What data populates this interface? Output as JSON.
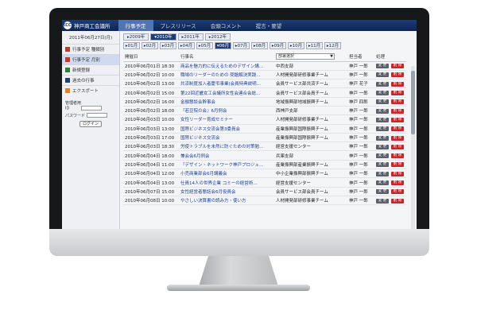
{
  "app": {
    "org_name": "神戸商工会議所",
    "logo_text": "KCCI"
  },
  "nav": {
    "tabs": [
      {
        "label": "行事予定",
        "active": true
      },
      {
        "label": "プレスリリース",
        "active": false
      },
      {
        "label": "会頭コメント",
        "active": false
      },
      {
        "label": "提言・要望",
        "active": false
      }
    ]
  },
  "sidebar": {
    "date": "2011年06月27日(月)",
    "items": [
      {
        "label": "行事予定 種類別",
        "icon": "calendar-icon",
        "active": false
      },
      {
        "label": "行事予定 月別",
        "icon": "calendar-icon",
        "active": true
      },
      {
        "label": "新規登録",
        "icon": "new-icon",
        "active": false
      },
      {
        "label": "過去の行事",
        "icon": "archive-icon",
        "active": false
      },
      {
        "label": "エクスポート",
        "icon": "export-icon",
        "active": false
      }
    ],
    "login": {
      "title": "管理者用",
      "id_label": "ID",
      "password_label": "パスワード",
      "button": "ログイン"
    }
  },
  "years": [
    {
      "label": "▸2009年",
      "active": false
    },
    {
      "label": "▾2010年",
      "active": true
    },
    {
      "label": "▸2011年",
      "active": false
    },
    {
      "label": "▸2012年",
      "active": false
    }
  ],
  "months": [
    {
      "label": "▸01月",
      "active": false
    },
    {
      "label": "▸02月",
      "active": false
    },
    {
      "label": "▸03月",
      "active": false
    },
    {
      "label": "▸04月",
      "active": false
    },
    {
      "label": "▸05月",
      "active": false
    },
    {
      "label": "▾06月",
      "active": true
    },
    {
      "label": "▸07月",
      "active": false
    },
    {
      "label": "▸08月",
      "active": false
    },
    {
      "label": "▸09月",
      "active": false
    },
    {
      "label": "▸10月",
      "active": false
    },
    {
      "label": "▸11月",
      "active": false
    },
    {
      "label": "▸12月",
      "active": false
    }
  ],
  "table": {
    "headers": [
      "開催日",
      "行事名",
      "",
      "担当者",
      "処理"
    ],
    "dept_filter": "部署選択",
    "edit_label": "変 更",
    "delete_label": "削 除",
    "rows": [
      {
        "date": "2010年06月01日 18:30",
        "title": "商品を魅力的に伝えるためのデザイン講…",
        "dept": "中西支部",
        "person": "神戸 一郎"
      },
      {
        "date": "2010年06月02日 10:00",
        "title": "職場のリーダーのための 問題解決実践…",
        "dept": "人材開発部研修事業チーム",
        "person": "神戸 一郎"
      },
      {
        "date": "2010年06月02日 13:00",
        "title": "共済制度加入者慶弔事業(会員特典説明…",
        "dept": "会員サービス部共済チーム",
        "person": "神戸 花子"
      },
      {
        "date": "2010年06月02日 15:00",
        "title": "第22回近畿女工会議所女性会連合会総…",
        "dept": "会員サービス部会員チーム",
        "person": "神戸 一郎"
      },
      {
        "date": "2010年06月02日 16:00",
        "title": "金融懇談会幹事会",
        "dept": "地域振興部地域振興チーム",
        "person": "神戸 四郎"
      },
      {
        "date": "2010年06月02日 18:00",
        "title": "『若豆院の会』6月例会",
        "dept": "西神戸支部",
        "person": "神戸 一郎"
      },
      {
        "date": "2010年06月03日 10:00",
        "title": "女性リーダー育成セミナー",
        "dept": "人材開発部研修事業チーム",
        "person": "神戸 一郎"
      },
      {
        "date": "2010年06月03日 13:00",
        "title": "国際ビジネス交流会第3委員会",
        "dept": "産業振興部国際振興チーム",
        "person": "神戸 一郎"
      },
      {
        "date": "2010年06月03日 17:00",
        "title": "国際ビジネス交流会",
        "dept": "産業振興部国際振興チーム",
        "person": "神戸 一郎"
      },
      {
        "date": "2010年06月03日 18:30",
        "title": "労使トラブルを未然に防ぐための対策勉…",
        "dept": "経営支援センター",
        "person": "神戸 一郎"
      },
      {
        "date": "2010年06月04日 18:00",
        "title": "兼会会6月例会",
        "dept": "兵庫支部",
        "person": "神戸 一郎"
      },
      {
        "date": "2010年06月04日 11:00",
        "title": "『デザイン・ネットワーク神戸プロジェ…",
        "dept": "産業振興部産業振興チーム",
        "person": "神戸 一郎"
      },
      {
        "date": "2010年06月04日 12:00",
        "title": "小売商業部会6月講義会",
        "dept": "中小企業振興部振興チーム",
        "person": "神戸 一郎"
      },
      {
        "date": "2010年06月04日 13:00",
        "title": "仕員14人の世界企業 コミーの経営術…",
        "dept": "経営支援センター",
        "person": "神戸 一郎"
      },
      {
        "date": "2010年06月07日 15:00",
        "title": "女性経営者懇話会6月役員会",
        "dept": "会員サービス部会員チーム",
        "person": "神戸 一郎"
      },
      {
        "date": "2010年06月08日 10:00",
        "title": "やさしい決算書の読み方・使い方",
        "dept": "人材開発部研修事業チーム",
        "person": "神戸 一郎"
      }
    ]
  }
}
